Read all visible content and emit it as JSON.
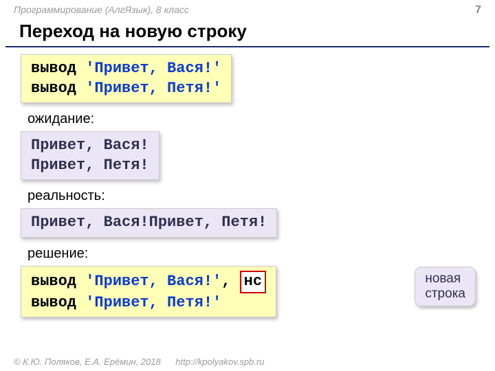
{
  "header": {
    "course": "Программирование (АлгЯзык), 8 класс",
    "page": "7"
  },
  "title": "Переход на новую строку",
  "code1": {
    "l1_kw": "вывод",
    "l1_str": "'Привет, Вася!'",
    "l2_kw": "вывод",
    "l2_str": "'Привет, Петя!'"
  },
  "labels": {
    "expect": "ожидание:",
    "reality": "реальность:",
    "solution": "решение:"
  },
  "out_expect": {
    "l1": "Привет, Вася!",
    "l2": "Привет, Петя!"
  },
  "out_real": "Привет, Вася!Привет, Петя!",
  "code2": {
    "l1_kw": "вывод",
    "l1_str": "'Привет, Вася!'",
    "l1_comma": ", ",
    "l1_hs": "нс",
    "l2_kw": "вывод",
    "l2_str": "'Привет, Петя!'"
  },
  "callout": {
    "l1": "новая",
    "l2": "строка"
  },
  "footer": {
    "copyright": "© К.Ю. Поляков, Е.А. Ерёмин, 2018",
    "url": "http://kpolyakov.spb.ru"
  }
}
